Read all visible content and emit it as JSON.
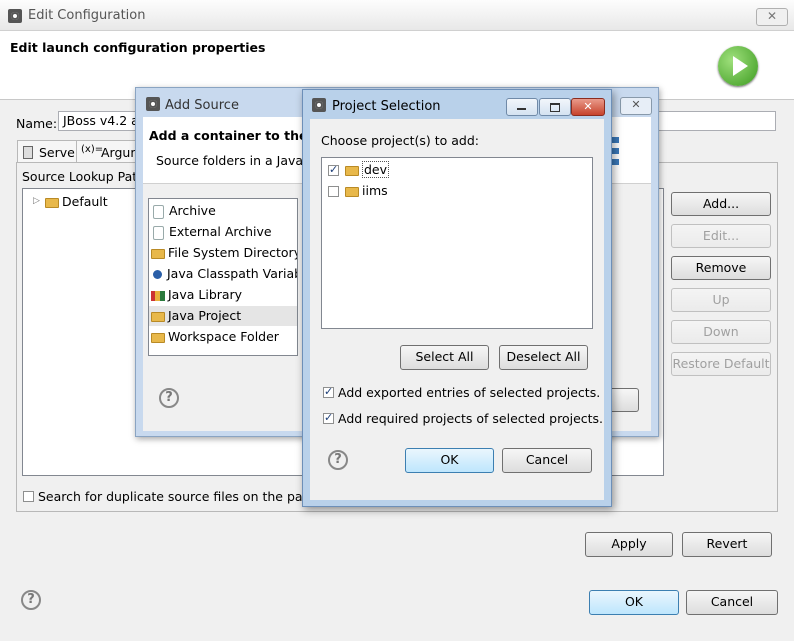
{
  "main_window": {
    "title": "Edit Configuration",
    "heading": "Edit launch configuration properties",
    "name_label": "Name:",
    "name_value": "JBoss v4.2 at",
    "tabs": [
      {
        "label": "Server"
      },
      {
        "label": "Argum"
      }
    ],
    "source_lookup_label": "Source Lookup Path",
    "tree_item": "Default",
    "buttons": {
      "add": "Add...",
      "edit": "Edit...",
      "remove": "Remove",
      "up": "Up",
      "down": "Down",
      "restore": "Restore Default"
    },
    "search_dup_label": "Search for duplicate source files on the path",
    "apply": "Apply",
    "revert": "Revert",
    "ok": "OK",
    "cancel": "Cancel"
  },
  "add_source": {
    "title": "Add Source",
    "heading": "Add a container to the so",
    "subheading": "Source folders in a Java P",
    "items": [
      {
        "label": "Archive",
        "icon": "archive-icon"
      },
      {
        "label": "External Archive",
        "icon": "archive-icon"
      },
      {
        "label": "File System Directory",
        "icon": "folder-icon"
      },
      {
        "label": "Java Classpath Variabl",
        "icon": "variable-icon"
      },
      {
        "label": "Java Library",
        "icon": "library-icon"
      },
      {
        "label": "Java Project",
        "icon": "project-icon"
      },
      {
        "label": "Workspace Folder",
        "icon": "folder-icon"
      }
    ]
  },
  "project_selection": {
    "title": "Project Selection",
    "prompt": "Choose project(s) to add:",
    "projects": [
      {
        "label": "dev",
        "checked": true
      },
      {
        "label": "iims",
        "checked": false
      }
    ],
    "select_all": "Select All",
    "deselect_all": "Deselect All",
    "add_exported": "Add exported entries of selected projects.",
    "add_required": "Add required projects of selected projects.",
    "ok": "OK",
    "cancel": "Cancel"
  }
}
